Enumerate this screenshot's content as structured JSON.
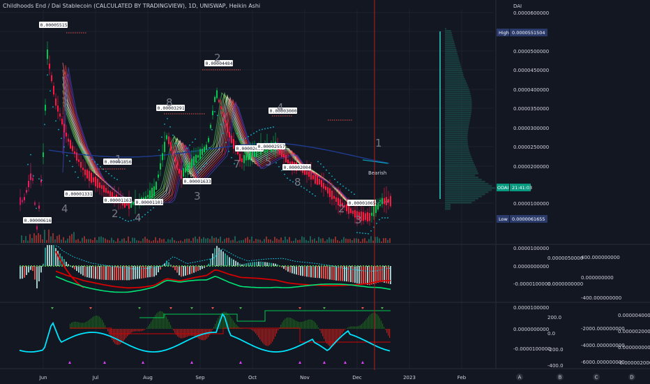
{
  "header": {
    "title": "Childhoods End / Dai Stablecoin (CALCULATED BY TRADINGVIEW), 1D, UNISWAP, Heikin Ashi",
    "currency": "DAI"
  },
  "price_axis": {
    "ticks": [
      "0.0000600000",
      "0.0000500000",
      "0.0000450000",
      "0.0000400000",
      "0.0000350000",
      "0.0000300000",
      "0.0000250000",
      "0.0000200000",
      "0.0000100000"
    ],
    "high_label": "High",
    "high_value": "0.0000551504",
    "symbol_tag": "ODAI",
    "countdown": "21:41:03",
    "low_label": "Low",
    "low_value": "0.0000061655"
  },
  "time_axis": [
    "Jun",
    "Jul",
    "Aug",
    "Sep",
    "Oct",
    "Nov",
    "Dec",
    "2023",
    "Feb"
  ],
  "bottom_badges": [
    "A",
    "B",
    "C",
    "D"
  ],
  "annotations": [
    {
      "text": "0.0000551504"
    },
    {
      "text": "0.0000448492"
    },
    {
      "text": "0.0000329124"
    },
    {
      "text": "0.0000300064"
    },
    {
      "text": "0.0000185671"
    },
    {
      "text": "0.0000249329"
    },
    {
      "text": "0.0000255713"
    },
    {
      "text": "0.0000200468"
    },
    {
      "text": "0.0000163354"
    },
    {
      "text": "0.0000133170"
    },
    {
      "text": "0.0000116303"
    },
    {
      "text": "0.0000110124"
    },
    {
      "text": "0.0000106529"
    },
    {
      "text": "0.0000061655"
    }
  ],
  "wave_labels": [
    "2",
    "8",
    "1",
    "4",
    "7",
    "5",
    "8",
    "4",
    "2",
    "4",
    "3",
    "2",
    "3",
    "1"
  ],
  "bearish_label": "Bearish",
  "osc1": {
    "left_ticks": [
      "0.0000100000",
      "0.0000000000",
      "-0.0000100000"
    ],
    "mid_ticks": [
      "0.0000050000",
      "0.0000000000"
    ],
    "right_ticks": [
      "400.000000000",
      "0.000000000",
      "-400.000000000"
    ]
  },
  "osc2": {
    "left_ticks": [
      "0.0000100000",
      "0.0000000000",
      "-0.0000100000"
    ],
    "mid_ticks": [
      "200.0",
      "0.0",
      "-200.0",
      "-400.0"
    ],
    "right_ticks": [
      "-2000.000000000",
      "-4000.000000000",
      "-6000.000000000"
    ],
    "far_ticks": [
      "0.0000040000",
      "0.0000020000",
      "0.0000000000",
      "-0.0000020000"
    ]
  },
  "colors": {
    "background": "#131722",
    "bull": "#26a69a",
    "bull_bright": "#4caf50",
    "bear": "#ef5350",
    "cyan": "#00e5ff",
    "high_tag": "#2a3a6b",
    "symbol_tag": "#089981"
  },
  "chart_data": {
    "type": "candlestick",
    "title": "Childhoods End / Dai Stablecoin (CALCULATED BY TRADINGVIEW), 1D, UNISWAP, Heikin Ashi",
    "x_categories": [
      "Jun",
      "Jul",
      "Aug",
      "Sep",
      "Oct",
      "Nov",
      "Dec"
    ],
    "y_label": "DAI",
    "ylim": [
      5e-06,
      6.5e-05
    ],
    "high": 5.51504e-05,
    "low": 6.1655e-06,
    "series": [
      {
        "name": "price",
        "points": [
          {
            "x": "May 20",
            "y": 1.5e-05
          },
          {
            "x": "May 25",
            "y": 2.3e-05
          },
          {
            "x": "May 28",
            "y": 7e-06
          },
          {
            "x": "Jun 01",
            "y": 3e-05
          },
          {
            "x": "Jun 03",
            "y": 5.51504e-05
          },
          {
            "x": "Jun 08",
            "y": 4.2e-05
          },
          {
            "x": "Jun 15",
            "y": 3.2e-05
          },
          {
            "x": "Jun 25",
            "y": 2.3e-05
          },
          {
            "x": "Jul 05",
            "y": 1.85671e-05
          },
          {
            "x": "Jul 12",
            "y": 1.6e-05
          },
          {
            "x": "Jul 20",
            "y": 1.4e-05
          },
          {
            "x": "Jul 28",
            "y": 1.5e-05
          },
          {
            "x": "Aug 05",
            "y": 1.8e-05
          },
          {
            "x": "Aug 12",
            "y": 3.29124e-05
          },
          {
            "x": "Aug 20",
            "y": 2.2e-05
          },
          {
            "x": "Aug 28",
            "y": 2.6e-05
          },
          {
            "x": "Sep 05",
            "y": 3e-05
          },
          {
            "x": "Sep 10",
            "y": 4.48492e-05
          },
          {
            "x": "Sep 18",
            "y": 3.3e-05
          },
          {
            "x": "Sep 25",
            "y": 2.6e-05
          },
          {
            "x": "Oct 05",
            "y": 2.9e-05
          },
          {
            "x": "Oct 15",
            "y": 3.00064e-05
          },
          {
            "x": "Oct 22",
            "y": 2.55713e-05
          },
          {
            "x": "Nov 01",
            "y": 2.3e-05
          },
          {
            "x": "Nov 10",
            "y": 2.00468e-05
          },
          {
            "x": "Nov 20",
            "y": 1.5e-05
          },
          {
            "x": "Dec 01",
            "y": 1.1e-05
          },
          {
            "x": "Dec 08",
            "y": 1.06529e-05
          },
          {
            "x": "Dec 15",
            "y": 1.5e-05
          }
        ]
      }
    ]
  }
}
